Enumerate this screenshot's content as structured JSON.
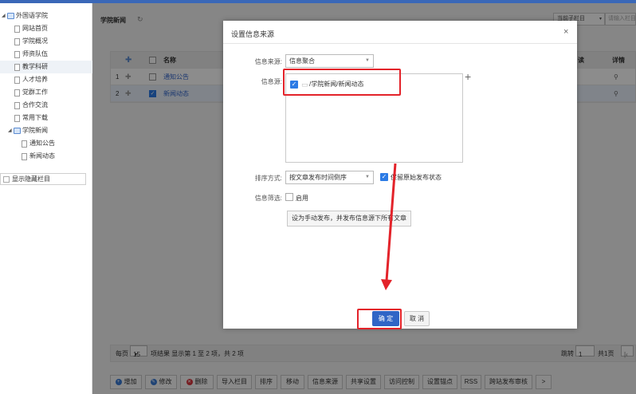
{
  "sidebar": {
    "root": "外国语学院",
    "items": [
      {
        "label": "网站首页"
      },
      {
        "label": "学院概况"
      },
      {
        "label": "师资队伍"
      },
      {
        "label": "教学科研"
      },
      {
        "label": "人才培养"
      },
      {
        "label": "党群工作"
      },
      {
        "label": "合作交流"
      },
      {
        "label": "常用下载"
      }
    ],
    "folder": {
      "label": "学院新闻",
      "children": [
        {
          "label": "通知公告"
        },
        {
          "label": "新闻动态"
        }
      ]
    },
    "show_hidden": "显示隐藏栏目"
  },
  "content": {
    "breadcrumb": "学院新闻",
    "top_select": "当前子栏目",
    "search_placeholder": "请输入栏目",
    "table": {
      "headers": {
        "name": "名称",
        "read": "读",
        "detail": "详情"
      },
      "rows": [
        {
          "index": "1",
          "name": "通知公告",
          "checked": false
        },
        {
          "index": "2",
          "name": "新闻动态",
          "checked": true
        }
      ]
    },
    "pager": {
      "per_page_label": "每页",
      "per_page_value": "15",
      "result_text": "项结果 显示第 1 至 2 项，共 2 项",
      "jump_label": "跳转",
      "page_value": "1",
      "total_pages": "共1页",
      "first_label": "|‹"
    },
    "toolbar": {
      "add": "增加",
      "edit": "修改",
      "delete": "删除",
      "import": "导入栏目",
      "sort": "排序",
      "move": "移动",
      "info_source": "信息来源",
      "share": "共享设置",
      "access": "访问控制",
      "anchor": "设置锚点",
      "rss": "RSS",
      "review": "跨站发布审核",
      "more": ">"
    }
  },
  "modal": {
    "title": "设置信息来源",
    "close": "×",
    "source_type_label": "信息来源:",
    "source_type_value": "信息聚合",
    "source_label": "信息源:",
    "source_path": "/学院新闻/新闻动态",
    "add_icon": "+",
    "sort_label": "排序方式:",
    "sort_value": "按文章发布时间倒序",
    "keep_status_label": "保留原始发布状态",
    "filter_label": "信息筛选:",
    "filter_enable": "启用",
    "action_button": "设为手动发布，并发布信息源下所有文章",
    "ok": "确 定",
    "cancel": "取 消"
  },
  "colors": {
    "accent": "#3065c6",
    "annotation": "#e3232a",
    "checkbox": "#2c7be5"
  }
}
